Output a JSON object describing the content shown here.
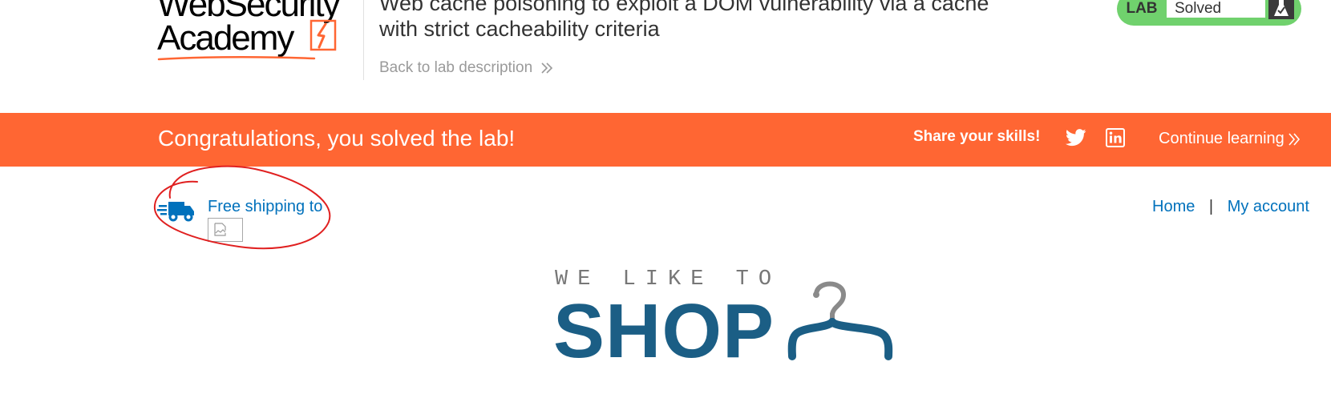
{
  "header": {
    "logo_line1": "WebSecurity",
    "logo_line2": "Academy",
    "lab_title_line1": "Web cache poisoning to exploit a DOM vulnerability via a cache",
    "lab_title_line2": "with strict cacheability criteria",
    "back_link": "Back to lab description",
    "status_label": "LAB",
    "status_value": "Solved",
    "status_icon": "flask-icon"
  },
  "banner": {
    "message": "Congratulations, you solved the lab!",
    "share_label": "Share your skills!",
    "share_icons": [
      "twitter-icon",
      "linkedin-icon"
    ],
    "continue_link": "Continue learning"
  },
  "shop_nav": {
    "shipping_text": "Free shipping to",
    "shipping_icon": "truck-icon",
    "home_link": "Home",
    "separator": "|",
    "account_link": "My account"
  },
  "hero": {
    "tagline": "WE LIKE TO",
    "title": "SHOP",
    "icon": "hanger-icon"
  },
  "colors": {
    "banner": "#ff6633",
    "status_green": "#70d16d",
    "link_blue": "#0071bc",
    "shop_blue": "#1b5e85",
    "annotation_red": "#e02020"
  }
}
